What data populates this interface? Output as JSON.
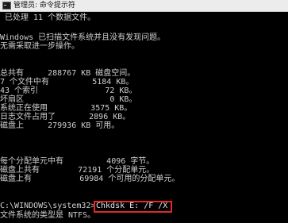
{
  "window": {
    "title": "管理员: 命令提示符"
  },
  "console": {
    "lines": [
      " 已处理 11 个数据文件。",
      "",
      "Windows 已扫描文件系统并且没有发现问题。",
      "无需采取进一步操作。",
      "",
      "总共有     288767 KB 磁盘空间。",
      "7 个文件中有         5184 KB。",
      "43 个索引              72 KB。",
      "坏扇区                  0 KB。",
      "系统正在使用         3575 KB。",
      "日志文件占用了       2896 KB。",
      "磁盘上     279936 KB 可用。",
      "",
      "每个分配单元中有         4096 字节。",
      "磁盘上共有        72191 个分配单元。",
      "磁盘上有          69984 个可用的分配单元。",
      "",
      "C:\\WINDOWS\\system32>",
      "文件系统的类型是 NTFS。"
    ],
    "prompt": "C:\\WINDOWS\\system32>",
    "command": "Chkdsk E: /F /X",
    "highlight_color": "#e0282a"
  }
}
